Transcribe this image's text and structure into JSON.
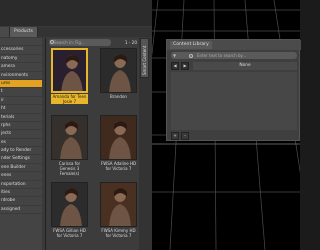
{
  "left_panel": {
    "tabs": [
      "",
      "Products"
    ],
    "search": {
      "placeholder": "Search in: Fig..."
    },
    "pager": "1 - 20",
    "categories": [
      {
        "label": "",
        "selected": false
      },
      {
        "label": "ccessories",
        "selected": false
      },
      {
        "label": "natomy",
        "selected": false
      },
      {
        "label": "amera",
        "selected": false
      },
      {
        "label": "nvironments",
        "selected": false
      },
      {
        "label": "ures",
        "selected": true
      },
      {
        "label": "t",
        "selected": false
      },
      {
        "label": "ir",
        "selected": false
      },
      {
        "label": "ht",
        "selected": false
      },
      {
        "label": "terials",
        "selected": false
      },
      {
        "label": "rphs",
        "selected": false
      },
      {
        "label": "jects",
        "selected": false
      },
      {
        "label": "es",
        "selected": false
      },
      {
        "label": "ady to Render",
        "selected": false
      },
      {
        "label": "nder Settings",
        "selected": false
      },
      {
        "label": "ene Builder",
        "selected": false
      },
      {
        "label": "enes",
        "selected": false
      },
      {
        "label": "nsportation",
        "selected": false
      },
      {
        "label": "ities",
        "selected": false
      },
      {
        "label": "rdrobe",
        "selected": false
      },
      {
        "label": "assigned",
        "selected": false
      }
    ],
    "items": [
      {
        "label": "Amanda for Teen Josie 7",
        "selected": true,
        "tone": "#2a1f2e"
      },
      {
        "label": "Brandon",
        "selected": false,
        "tone": "#2b2b2b"
      },
      {
        "label": "Carissa for Genesis 3 Female(s)",
        "selected": false,
        "tone": "#35302b"
      },
      {
        "label": "FWSA Adaline HD for Victoria 7",
        "selected": false,
        "tone": "#402a1e"
      },
      {
        "label": "FWSA Gillian HD for Victoria 7",
        "selected": false,
        "tone": "#2c2c2c"
      },
      {
        "label": "FWSA Kimmy HD for Victoria 7",
        "selected": false,
        "tone": "#4a3020"
      }
    ],
    "side_tab": "Smart Content"
  },
  "content_library": {
    "title": "Content Library",
    "search_placeholder": "Enter text to search by...",
    "nav_value": "None"
  },
  "colors": {
    "accent": "#e4a222",
    "viewport_bg": "#000000",
    "grid_line": "#5a5a5a",
    "panel_bg": "#3a3a3a"
  }
}
